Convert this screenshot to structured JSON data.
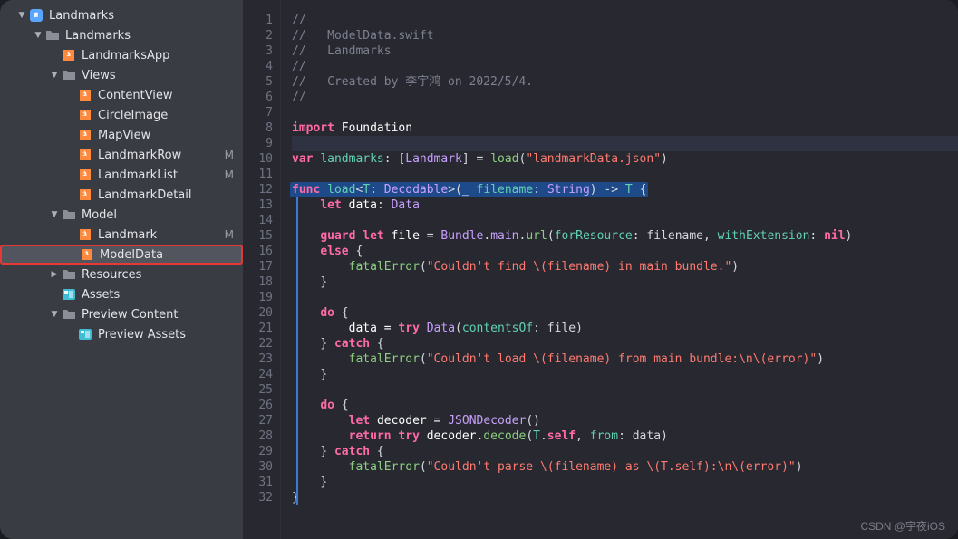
{
  "sidebar": {
    "items": [
      {
        "depth": 0,
        "chev": "down",
        "icon": "project",
        "label": "Landmarks",
        "m": false
      },
      {
        "depth": 1,
        "chev": "down",
        "icon": "folder",
        "label": "Landmarks",
        "m": false
      },
      {
        "depth": 2,
        "chev": "none",
        "icon": "swift",
        "label": "LandmarksApp",
        "m": false
      },
      {
        "depth": 2,
        "chev": "down",
        "icon": "folder",
        "label": "Views",
        "m": false
      },
      {
        "depth": 3,
        "chev": "none",
        "icon": "swift",
        "label": "ContentView",
        "m": false
      },
      {
        "depth": 3,
        "chev": "none",
        "icon": "swift",
        "label": "CircleImage",
        "m": false
      },
      {
        "depth": 3,
        "chev": "none",
        "icon": "swift",
        "label": "MapView",
        "m": false
      },
      {
        "depth": 3,
        "chev": "none",
        "icon": "swift",
        "label": "LandmarkRow",
        "m": true
      },
      {
        "depth": 3,
        "chev": "none",
        "icon": "swift",
        "label": "LandmarkList",
        "m": true
      },
      {
        "depth": 3,
        "chev": "none",
        "icon": "swift",
        "label": "LandmarkDetail",
        "m": false
      },
      {
        "depth": 2,
        "chev": "down",
        "icon": "folder",
        "label": "Model",
        "m": false
      },
      {
        "depth": 3,
        "chev": "none",
        "icon": "swift",
        "label": "Landmark",
        "m": true
      },
      {
        "depth": 3,
        "chev": "none",
        "icon": "swift",
        "label": "ModelData",
        "m": false,
        "selected": true,
        "redbox": true
      },
      {
        "depth": 2,
        "chev": "right",
        "icon": "folder",
        "label": "Resources",
        "m": false,
        "redtop": true
      },
      {
        "depth": 2,
        "chev": "none",
        "icon": "assets",
        "label": "Assets",
        "m": false
      },
      {
        "depth": 2,
        "chev": "down",
        "icon": "folder",
        "label": "Preview Content",
        "m": false
      },
      {
        "depth": 3,
        "chev": "none",
        "icon": "assets",
        "label": "Preview Assets",
        "m": false
      }
    ],
    "m_badge": "M"
  },
  "code": {
    "sel_line": 12,
    "lines": [
      {
        "n": 1,
        "t": [
          [
            "c-comment",
            "//"
          ]
        ]
      },
      {
        "n": 2,
        "t": [
          [
            "c-comment",
            "//   ModelData.swift"
          ]
        ]
      },
      {
        "n": 3,
        "t": [
          [
            "c-comment",
            "//   Landmarks"
          ]
        ]
      },
      {
        "n": 4,
        "t": [
          [
            "c-comment",
            "//"
          ]
        ]
      },
      {
        "n": 5,
        "t": [
          [
            "c-comment",
            "//   Created by 李宇鸿 on 2022/5/4."
          ]
        ]
      },
      {
        "n": 6,
        "t": [
          [
            "c-comment",
            "//"
          ]
        ]
      },
      {
        "n": 7,
        "t": []
      },
      {
        "n": 8,
        "t": [
          [
            "c-key",
            "import "
          ],
          [
            "c-white",
            "Foundation"
          ]
        ]
      },
      {
        "n": 9,
        "t": [],
        "cursor": true
      },
      {
        "n": 10,
        "t": [
          [
            "c-key",
            "var "
          ],
          [
            "c-func",
            "landmarks"
          ],
          [
            "c-punc",
            ": ["
          ],
          [
            "c-typeref",
            "Landmark"
          ],
          [
            "c-punc",
            "] = "
          ],
          [
            "c-call",
            "load"
          ],
          [
            "c-punc",
            "("
          ],
          [
            "c-str",
            "\"landmarkData.json\""
          ],
          [
            "c-punc",
            ")"
          ]
        ]
      },
      {
        "n": 11,
        "t": []
      },
      {
        "n": 12,
        "sel": true,
        "t": [
          [
            "c-key",
            "func "
          ],
          [
            "c-func",
            "load"
          ],
          [
            "c-punc",
            "<"
          ],
          [
            "c-type",
            "T"
          ],
          [
            "c-punc",
            ": "
          ],
          [
            "c-typeref",
            "Decodable"
          ],
          [
            "c-punc",
            ">("
          ],
          [
            "c-white",
            "_ "
          ],
          [
            "c-param",
            "filename"
          ],
          [
            "c-punc",
            ": "
          ],
          [
            "c-typeref",
            "String"
          ],
          [
            "c-punc",
            ") -> "
          ],
          [
            "c-type",
            "T"
          ],
          [
            "c-punc",
            " {"
          ]
        ]
      },
      {
        "n": 13,
        "bar": true,
        "t": [
          [
            "",
            "    "
          ],
          [
            "c-key",
            "let "
          ],
          [
            "c-white",
            "data"
          ],
          [
            "c-punc",
            ": "
          ],
          [
            "c-typeref",
            "Data"
          ]
        ]
      },
      {
        "n": 14,
        "bar": true,
        "t": []
      },
      {
        "n": 15,
        "bar": true,
        "t": [
          [
            "",
            "    "
          ],
          [
            "c-key",
            "guard let "
          ],
          [
            "c-white",
            "file"
          ],
          [
            "c-punc",
            " = "
          ],
          [
            "c-typeref",
            "Bundle"
          ],
          [
            "c-punc",
            "."
          ],
          [
            "c-callp",
            "main"
          ],
          [
            "c-punc",
            "."
          ],
          [
            "c-call",
            "url"
          ],
          [
            "c-punc",
            "("
          ],
          [
            "c-param",
            "forResource"
          ],
          [
            "c-punc",
            ": filename, "
          ],
          [
            "c-param",
            "withExtension"
          ],
          [
            "c-punc",
            ": "
          ],
          [
            "c-key",
            "nil"
          ],
          [
            "c-punc",
            ")"
          ]
        ]
      },
      {
        "n": 16,
        "bar": true,
        "t": [
          [
            "",
            "    "
          ],
          [
            "c-key",
            "else"
          ],
          [
            "c-punc",
            " {"
          ]
        ]
      },
      {
        "n": 17,
        "bar": true,
        "t": [
          [
            "",
            "        "
          ],
          [
            "c-call",
            "fatalError"
          ],
          [
            "c-punc",
            "("
          ],
          [
            "c-str",
            "\"Couldn't find \\(filename) in main bundle.\""
          ],
          [
            "c-punc",
            ")"
          ]
        ]
      },
      {
        "n": 18,
        "bar": true,
        "t": [
          [
            "",
            "    "
          ],
          [
            "c-punc",
            "}"
          ]
        ]
      },
      {
        "n": 19,
        "bar": true,
        "t": []
      },
      {
        "n": 20,
        "bar": true,
        "t": [
          [
            "",
            "    "
          ],
          [
            "c-key",
            "do"
          ],
          [
            "c-punc",
            " {"
          ]
        ]
      },
      {
        "n": 21,
        "bar": true,
        "t": [
          [
            "",
            "        "
          ],
          [
            "c-white",
            "data = "
          ],
          [
            "c-key",
            "try "
          ],
          [
            "c-typeref",
            "Data"
          ],
          [
            "c-punc",
            "("
          ],
          [
            "c-param",
            "contentsOf"
          ],
          [
            "c-punc",
            ": file)"
          ]
        ]
      },
      {
        "n": 22,
        "bar": true,
        "t": [
          [
            "",
            "    "
          ],
          [
            "c-punc",
            "} "
          ],
          [
            "c-key",
            "catch"
          ],
          [
            "c-punc",
            " {"
          ]
        ]
      },
      {
        "n": 23,
        "bar": true,
        "t": [
          [
            "",
            "        "
          ],
          [
            "c-call",
            "fatalError"
          ],
          [
            "c-punc",
            "("
          ],
          [
            "c-str",
            "\"Couldn't load \\(filename) from main bundle:\\n\\(error)\""
          ],
          [
            "c-punc",
            ")"
          ]
        ]
      },
      {
        "n": 24,
        "bar": true,
        "t": [
          [
            "",
            "    "
          ],
          [
            "c-punc",
            "}"
          ]
        ]
      },
      {
        "n": 25,
        "bar": true,
        "t": []
      },
      {
        "n": 26,
        "bar": true,
        "t": [
          [
            "",
            "    "
          ],
          [
            "c-key",
            "do"
          ],
          [
            "c-punc",
            " {"
          ]
        ]
      },
      {
        "n": 27,
        "bar": true,
        "t": [
          [
            "",
            "        "
          ],
          [
            "c-key",
            "let "
          ],
          [
            "c-white",
            "decoder = "
          ],
          [
            "c-callp",
            "JSONDecoder"
          ],
          [
            "c-punc",
            "()"
          ]
        ]
      },
      {
        "n": 28,
        "bar": true,
        "t": [
          [
            "",
            "        "
          ],
          [
            "c-key",
            "return try "
          ],
          [
            "c-white",
            "decoder."
          ],
          [
            "c-call",
            "decode"
          ],
          [
            "c-punc",
            "("
          ],
          [
            "c-type",
            "T"
          ],
          [
            "c-punc",
            "."
          ],
          [
            "c-key",
            "self"
          ],
          [
            "c-punc",
            ", "
          ],
          [
            "c-param",
            "from"
          ],
          [
            "c-punc",
            ": data)"
          ]
        ]
      },
      {
        "n": 29,
        "bar": true,
        "t": [
          [
            "",
            "    "
          ],
          [
            "c-punc",
            "} "
          ],
          [
            "c-key",
            "catch"
          ],
          [
            "c-punc",
            " {"
          ]
        ]
      },
      {
        "n": 30,
        "bar": true,
        "t": [
          [
            "",
            "        "
          ],
          [
            "c-call",
            "fatalError"
          ],
          [
            "c-punc",
            "("
          ],
          [
            "c-str",
            "\"Couldn't parse \\(filename) as \\(T.self):\\n\\(error)\""
          ],
          [
            "c-punc",
            ")"
          ]
        ]
      },
      {
        "n": 31,
        "bar": true,
        "t": [
          [
            "",
            "    "
          ],
          [
            "c-punc",
            "}"
          ]
        ]
      },
      {
        "n": 32,
        "bar": true,
        "t": [
          [
            "c-punc",
            "}"
          ]
        ]
      }
    ]
  },
  "watermark": "CSDN @宇夜iOS"
}
